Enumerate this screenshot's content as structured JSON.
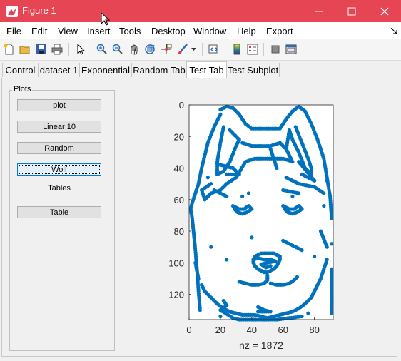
{
  "window": {
    "title": "Figure 1"
  },
  "menu": [
    "File",
    "Edit",
    "View",
    "Insert",
    "Tools",
    "Desktop",
    "Window",
    "Help",
    "Export"
  ],
  "toolbar": [
    "new-figure-icon",
    "open-icon",
    "save-icon",
    "print-icon",
    "pointer-icon",
    "zoom-in-icon",
    "zoom-out-icon",
    "pan-icon",
    "rotate-icon",
    "data-cursor-icon",
    "brush-icon",
    "dropdown-arrow-icon",
    "link-plot-icon",
    "colorbar-icon",
    "legend-icon",
    "hide-plot-tools-icon",
    "show-plot-tools-icon"
  ],
  "tabs": [
    {
      "label": "Control"
    },
    {
      "label": "dataset 1"
    },
    {
      "label": "Exponential"
    },
    {
      "label": "Random Tab"
    },
    {
      "label": "Test Tab",
      "active": true
    },
    {
      "label": "Test Subplot"
    }
  ],
  "panel": {
    "title": "Plots",
    "buttons": {
      "plot": "plot",
      "linear": "Linear 10",
      "random": "Random",
      "wolf": "Wolf",
      "table": "Table"
    },
    "tables_label": "Tables"
  },
  "colors": {
    "titlebar": "#e64553",
    "marker": "#0072bd"
  },
  "chart_data": {
    "type": "scatter",
    "description_type": "spy",
    "xlabel": "nz = 1872",
    "xlim": [
      0,
      92
    ],
    "ylim": [
      0,
      136
    ],
    "y_reversed": true,
    "xticks": [
      "0",
      "20",
      "40",
      "60",
      "80"
    ],
    "yticks": [
      "0",
      "20",
      "40",
      "60",
      "80",
      "100",
      "120"
    ],
    "marker_color": "#0072bd",
    "series": [
      {
        "name": "outline",
        "points": [
          [
            20,
            3
          ],
          [
            24,
            1
          ],
          [
            28,
            2
          ],
          [
            32,
            6
          ],
          [
            36,
            12
          ],
          [
            40,
            15
          ],
          [
            46,
            15
          ],
          [
            52,
            15
          ],
          [
            58,
            15
          ],
          [
            62,
            9
          ],
          [
            66,
            4
          ],
          [
            70,
            1
          ],
          [
            74,
            4
          ],
          [
            78,
            12
          ],
          [
            82,
            22
          ],
          [
            86,
            34
          ],
          [
            88,
            46
          ],
          [
            90,
            58
          ],
          [
            91,
            72
          ],
          [
            91,
            88
          ],
          [
            91,
            104
          ],
          [
            91,
            118
          ],
          [
            91,
            132
          ],
          [
            20,
            6
          ],
          [
            16,
            14
          ],
          [
            12,
            24
          ],
          [
            10,
            32
          ],
          [
            8,
            40
          ],
          [
            6,
            50
          ],
          [
            4,
            56
          ],
          [
            2,
            62
          ],
          [
            1,
            66
          ],
          [
            2,
            72
          ],
          [
            3,
            82
          ],
          [
            4,
            92
          ],
          [
            5,
            104
          ],
          [
            6,
            118
          ],
          [
            7,
            130
          ]
        ]
      },
      {
        "name": "left-ear",
        "points": [
          [
            22,
            14
          ],
          [
            20,
            24
          ],
          [
            18,
            36
          ],
          [
            18,
            44
          ],
          [
            22,
            42
          ],
          [
            26,
            36
          ],
          [
            30,
            26
          ],
          [
            32,
            22
          ],
          [
            26,
            16
          ],
          [
            20,
            38
          ],
          [
            28,
            40
          ],
          [
            32,
            44
          ],
          [
            24,
            44
          ]
        ]
      },
      {
        "name": "right-ear",
        "points": [
          [
            68,
            14
          ],
          [
            72,
            24
          ],
          [
            76,
            34
          ],
          [
            78,
            40
          ],
          [
            78,
            44
          ],
          [
            74,
            40
          ],
          [
            70,
            30
          ],
          [
            66,
            22
          ],
          [
            64,
            16
          ],
          [
            62,
            28
          ],
          [
            72,
            44
          ],
          [
            80,
            48
          ],
          [
            70,
            36
          ]
        ]
      },
      {
        "name": "forehead",
        "points": [
          [
            34,
            24
          ],
          [
            40,
            26
          ],
          [
            46,
            26
          ],
          [
            52,
            26
          ],
          [
            58,
            24
          ],
          [
            62,
            28
          ],
          [
            66,
            36
          ],
          [
            60,
            34
          ],
          [
            50,
            34
          ],
          [
            42,
            34
          ],
          [
            36,
            36
          ],
          [
            30,
            46
          ],
          [
            24,
            50
          ],
          [
            20,
            54
          ],
          [
            14,
            56
          ],
          [
            10,
            60
          ],
          [
            8,
            54
          ],
          [
            14,
            50
          ],
          [
            62,
            46
          ],
          [
            70,
            50
          ],
          [
            80,
            52
          ],
          [
            86,
            56
          ]
        ]
      },
      {
        "name": "left-eye",
        "points": [
          [
            28,
            64
          ],
          [
            30,
            65
          ],
          [
            32,
            66
          ],
          [
            35,
            66
          ],
          [
            38,
            64
          ],
          [
            40,
            66
          ],
          [
            37,
            68
          ],
          [
            34,
            69
          ],
          [
            31,
            68
          ],
          [
            29,
            66
          ]
        ]
      },
      {
        "name": "right-eye",
        "points": [
          [
            60,
            64
          ],
          [
            62,
            65
          ],
          [
            64,
            66
          ],
          [
            67,
            66
          ],
          [
            70,
            64
          ],
          [
            72,
            66
          ],
          [
            69,
            68
          ],
          [
            66,
            69
          ],
          [
            63,
            68
          ],
          [
            61,
            66
          ]
        ]
      },
      {
        "name": "nose",
        "points": [
          [
            42,
            96
          ],
          [
            44,
            95
          ],
          [
            46,
            94
          ],
          [
            48,
            94
          ],
          [
            50,
            94
          ],
          [
            52,
            94
          ],
          [
            54,
            94
          ],
          [
            56,
            95
          ],
          [
            58,
            96
          ],
          [
            58,
            98
          ],
          [
            57,
            100
          ],
          [
            56,
            102
          ],
          [
            54,
            104
          ],
          [
            52,
            105
          ],
          [
            50,
            106
          ],
          [
            48,
            106
          ],
          [
            46,
            105
          ],
          [
            44,
            104
          ],
          [
            42,
            102
          ],
          [
            41,
            100
          ],
          [
            41,
            98
          ],
          [
            44,
            97
          ],
          [
            48,
            98
          ],
          [
            52,
            98
          ],
          [
            55,
            99
          ],
          [
            50,
            100
          ],
          [
            46,
            101
          ],
          [
            49,
            103
          ],
          [
            52,
            102
          ]
        ]
      },
      {
        "name": "mouth",
        "points": [
          [
            50,
            108
          ],
          [
            50,
            111
          ],
          [
            48,
            113
          ],
          [
            44,
            114
          ],
          [
            40,
            114
          ],
          [
            36,
            113
          ],
          [
            32,
            112
          ],
          [
            52,
            113
          ],
          [
            56,
            114
          ],
          [
            60,
            114
          ],
          [
            64,
            113
          ],
          [
            67,
            111
          ],
          [
            69,
            109
          ]
        ]
      },
      {
        "name": "jaw",
        "points": [
          [
            8,
            114
          ],
          [
            10,
            118
          ],
          [
            14,
            122
          ],
          [
            18,
            126
          ],
          [
            22,
            129
          ],
          [
            26,
            131
          ],
          [
            30,
            132
          ],
          [
            34,
            133
          ],
          [
            38,
            133
          ],
          [
            42,
            133
          ],
          [
            46,
            134
          ],
          [
            50,
            135
          ],
          [
            54,
            134
          ],
          [
            58,
            133
          ],
          [
            62,
            132
          ],
          [
            66,
            131
          ],
          [
            70,
            129
          ],
          [
            74,
            126
          ],
          [
            78,
            122
          ],
          [
            80,
            118
          ],
          [
            82,
            114
          ],
          [
            84,
            110
          ],
          [
            86,
            104
          ],
          [
            88,
            98
          ],
          [
            22,
            124
          ],
          [
            24,
            127
          ],
          [
            20,
            130
          ],
          [
            28,
            135
          ],
          [
            32,
            136
          ],
          [
            40,
            136
          ],
          [
            48,
            136
          ],
          [
            56,
            136
          ],
          [
            64,
            135
          ],
          [
            72,
            134
          ],
          [
            20,
            134
          ],
          [
            76,
            132
          ],
          [
            44,
            128
          ],
          [
            48,
            130
          ],
          [
            52,
            131
          ],
          [
            44,
            131
          ]
        ]
      },
      {
        "name": "speckle",
        "points": [
          [
            16,
            54
          ],
          [
            20,
            56
          ],
          [
            24,
            58
          ],
          [
            52,
            28
          ],
          [
            56,
            40
          ],
          [
            34,
            58
          ],
          [
            66,
            58
          ],
          [
            38,
            56
          ],
          [
            70,
            56
          ],
          [
            60,
            54
          ],
          [
            12,
            46
          ],
          [
            88,
            48
          ],
          [
            86,
            64
          ],
          [
            84,
            80
          ],
          [
            88,
            90
          ],
          [
            4,
            100
          ],
          [
            6,
            110
          ],
          [
            40,
            84
          ],
          [
            24,
            98
          ],
          [
            72,
            92
          ],
          [
            60,
            86
          ],
          [
            80,
            96
          ],
          [
            14,
            90
          ]
        ]
      }
    ]
  }
}
